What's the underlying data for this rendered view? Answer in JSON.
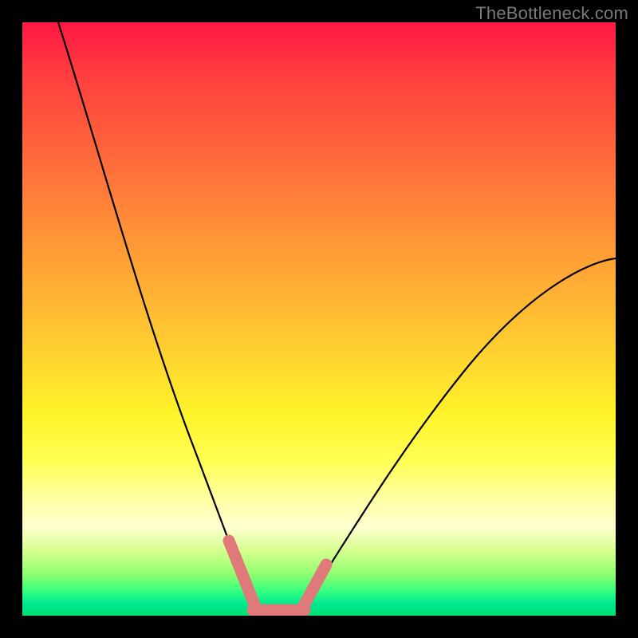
{
  "watermark": {
    "text": "TheBottleneck.com"
  },
  "chart_data": {
    "type": "line",
    "title": "",
    "xlabel": "",
    "ylabel": "",
    "xlim": [
      0,
      100
    ],
    "ylim": [
      0,
      100
    ],
    "gradient_stops": [
      {
        "pos": 0,
        "color": "#ff1744"
      },
      {
        "pos": 8,
        "color": "#ff3b3f"
      },
      {
        "pos": 18,
        "color": "#ff5a3c"
      },
      {
        "pos": 28,
        "color": "#ff7a3a"
      },
      {
        "pos": 38,
        "color": "#ff9a36"
      },
      {
        "pos": 48,
        "color": "#ffb933"
      },
      {
        "pos": 58,
        "color": "#ffd92f"
      },
      {
        "pos": 66,
        "color": "#fff32a"
      },
      {
        "pos": 74,
        "color": "#ffff55"
      },
      {
        "pos": 80,
        "color": "#ffffa0"
      },
      {
        "pos": 85,
        "color": "#ffffd0"
      },
      {
        "pos": 89,
        "color": "#d6ff8f"
      },
      {
        "pos": 93,
        "color": "#90ff70"
      },
      {
        "pos": 96,
        "color": "#32ff80"
      },
      {
        "pos": 98,
        "color": "#00e890"
      },
      {
        "pos": 100,
        "color": "#00e074"
      }
    ],
    "series": [
      {
        "name": "left-curve",
        "x": [
          6,
          10,
          14,
          18,
          22,
          26,
          30,
          34,
          37,
          39
        ],
        "y": [
          100,
          84,
          69,
          55,
          43,
          32,
          22,
          13,
          6,
          1
        ]
      },
      {
        "name": "right-curve",
        "x": [
          47,
          51,
          56,
          62,
          69,
          77,
          86,
          95,
          100
        ],
        "y": [
          1,
          7,
          15,
          24,
          33,
          42,
          50,
          57,
          60
        ]
      }
    ],
    "highlight_segments": [
      {
        "name": "left-marker",
        "color": "#e07a7a",
        "points": [
          {
            "x": 34.5,
            "y": 12
          },
          {
            "x": 38.5,
            "y": 2
          }
        ]
      },
      {
        "name": "bottom-marker",
        "color": "#e07a7a",
        "points": [
          {
            "x": 38.5,
            "y": 0.8
          },
          {
            "x": 47.5,
            "y": 0.8
          }
        ]
      },
      {
        "name": "right-marker",
        "color": "#e07a7a",
        "points": [
          {
            "x": 47,
            "y": 1
          },
          {
            "x": 51,
            "y": 8
          }
        ]
      }
    ]
  }
}
